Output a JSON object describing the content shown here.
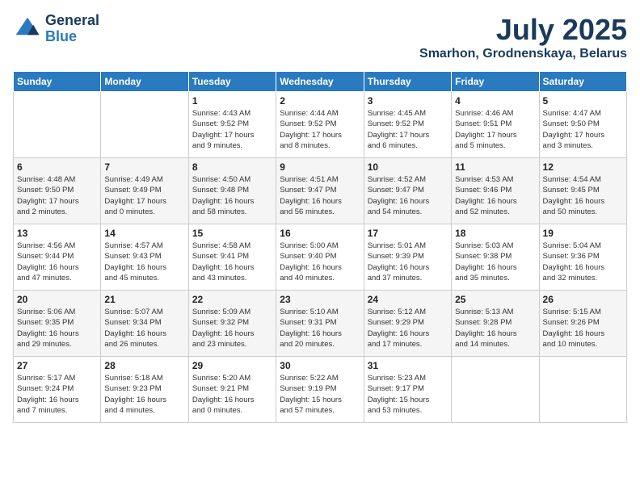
{
  "header": {
    "logo_line1": "General",
    "logo_line2": "Blue",
    "month": "July 2025",
    "location": "Smarhon, Grodnenskaya, Belarus"
  },
  "weekdays": [
    "Sunday",
    "Monday",
    "Tuesday",
    "Wednesday",
    "Thursday",
    "Friday",
    "Saturday"
  ],
  "weeks": [
    [
      {
        "day": "",
        "text": ""
      },
      {
        "day": "",
        "text": ""
      },
      {
        "day": "1",
        "text": "Sunrise: 4:43 AM\nSunset: 9:52 PM\nDaylight: 17 hours\nand 9 minutes."
      },
      {
        "day": "2",
        "text": "Sunrise: 4:44 AM\nSunset: 9:52 PM\nDaylight: 17 hours\nand 8 minutes."
      },
      {
        "day": "3",
        "text": "Sunrise: 4:45 AM\nSunset: 9:52 PM\nDaylight: 17 hours\nand 6 minutes."
      },
      {
        "day": "4",
        "text": "Sunrise: 4:46 AM\nSunset: 9:51 PM\nDaylight: 17 hours\nand 5 minutes."
      },
      {
        "day": "5",
        "text": "Sunrise: 4:47 AM\nSunset: 9:50 PM\nDaylight: 17 hours\nand 3 minutes."
      }
    ],
    [
      {
        "day": "6",
        "text": "Sunrise: 4:48 AM\nSunset: 9:50 PM\nDaylight: 17 hours\nand 2 minutes."
      },
      {
        "day": "7",
        "text": "Sunrise: 4:49 AM\nSunset: 9:49 PM\nDaylight: 17 hours\nand 0 minutes."
      },
      {
        "day": "8",
        "text": "Sunrise: 4:50 AM\nSunset: 9:48 PM\nDaylight: 16 hours\nand 58 minutes."
      },
      {
        "day": "9",
        "text": "Sunrise: 4:51 AM\nSunset: 9:47 PM\nDaylight: 16 hours\nand 56 minutes."
      },
      {
        "day": "10",
        "text": "Sunrise: 4:52 AM\nSunset: 9:47 PM\nDaylight: 16 hours\nand 54 minutes."
      },
      {
        "day": "11",
        "text": "Sunrise: 4:53 AM\nSunset: 9:46 PM\nDaylight: 16 hours\nand 52 minutes."
      },
      {
        "day": "12",
        "text": "Sunrise: 4:54 AM\nSunset: 9:45 PM\nDaylight: 16 hours\nand 50 minutes."
      }
    ],
    [
      {
        "day": "13",
        "text": "Sunrise: 4:56 AM\nSunset: 9:44 PM\nDaylight: 16 hours\nand 47 minutes."
      },
      {
        "day": "14",
        "text": "Sunrise: 4:57 AM\nSunset: 9:43 PM\nDaylight: 16 hours\nand 45 minutes."
      },
      {
        "day": "15",
        "text": "Sunrise: 4:58 AM\nSunset: 9:41 PM\nDaylight: 16 hours\nand 43 minutes."
      },
      {
        "day": "16",
        "text": "Sunrise: 5:00 AM\nSunset: 9:40 PM\nDaylight: 16 hours\nand 40 minutes."
      },
      {
        "day": "17",
        "text": "Sunrise: 5:01 AM\nSunset: 9:39 PM\nDaylight: 16 hours\nand 37 minutes."
      },
      {
        "day": "18",
        "text": "Sunrise: 5:03 AM\nSunset: 9:38 PM\nDaylight: 16 hours\nand 35 minutes."
      },
      {
        "day": "19",
        "text": "Sunrise: 5:04 AM\nSunset: 9:36 PM\nDaylight: 16 hours\nand 32 minutes."
      }
    ],
    [
      {
        "day": "20",
        "text": "Sunrise: 5:06 AM\nSunset: 9:35 PM\nDaylight: 16 hours\nand 29 minutes."
      },
      {
        "day": "21",
        "text": "Sunrise: 5:07 AM\nSunset: 9:34 PM\nDaylight: 16 hours\nand 26 minutes."
      },
      {
        "day": "22",
        "text": "Sunrise: 5:09 AM\nSunset: 9:32 PM\nDaylight: 16 hours\nand 23 minutes."
      },
      {
        "day": "23",
        "text": "Sunrise: 5:10 AM\nSunset: 9:31 PM\nDaylight: 16 hours\nand 20 minutes."
      },
      {
        "day": "24",
        "text": "Sunrise: 5:12 AM\nSunset: 9:29 PM\nDaylight: 16 hours\nand 17 minutes."
      },
      {
        "day": "25",
        "text": "Sunrise: 5:13 AM\nSunset: 9:28 PM\nDaylight: 16 hours\nand 14 minutes."
      },
      {
        "day": "26",
        "text": "Sunrise: 5:15 AM\nSunset: 9:26 PM\nDaylight: 16 hours\nand 10 minutes."
      }
    ],
    [
      {
        "day": "27",
        "text": "Sunrise: 5:17 AM\nSunset: 9:24 PM\nDaylight: 16 hours\nand 7 minutes."
      },
      {
        "day": "28",
        "text": "Sunrise: 5:18 AM\nSunset: 9:23 PM\nDaylight: 16 hours\nand 4 minutes."
      },
      {
        "day": "29",
        "text": "Sunrise: 5:20 AM\nSunset: 9:21 PM\nDaylight: 16 hours\nand 0 minutes."
      },
      {
        "day": "30",
        "text": "Sunrise: 5:22 AM\nSunset: 9:19 PM\nDaylight: 15 hours\nand 57 minutes."
      },
      {
        "day": "31",
        "text": "Sunrise: 5:23 AM\nSunset: 9:17 PM\nDaylight: 15 hours\nand 53 minutes."
      },
      {
        "day": "",
        "text": ""
      },
      {
        "day": "",
        "text": ""
      }
    ]
  ]
}
